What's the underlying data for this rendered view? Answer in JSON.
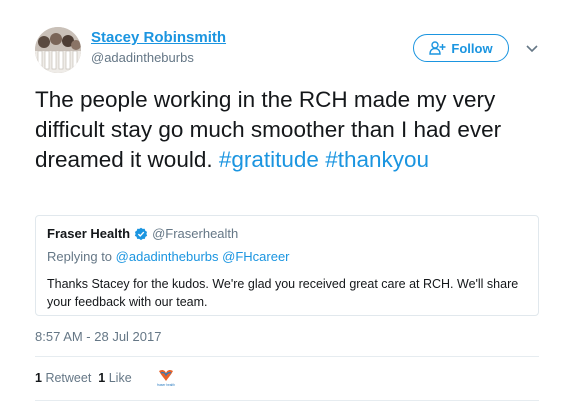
{
  "author": {
    "name": "Stacey Robinsmith",
    "handle": "@adadintheburbs",
    "follow_label": "Follow"
  },
  "tweet": {
    "text_plain": "The people working in the RCH made my very difficult stay go much smoother than I had ever dreamed it would. ",
    "hashtag_1": "#gratitude",
    "hashtag_2": "#thankyou"
  },
  "quote": {
    "name": "Fraser Health",
    "handle": "@Fraserhealth",
    "replying_prefix": "Replying to",
    "reply_to_1": "@adadintheburbs",
    "reply_to_2": "@FHcareer",
    "text": "Thanks Stacey for the kudos. We're glad you received great care at RCH. We'll share your feedback with our team."
  },
  "timestamp": "8:57 AM - 28 Jul 2017",
  "stats": {
    "retweet_count": "1",
    "retweet_label": "Retweet",
    "like_count": "1",
    "like_label": "Like",
    "liker_logo_text": "fraser health"
  },
  "colors": {
    "accent": "#1b95e0",
    "muted": "#657786",
    "text": "#14171a",
    "border": "#e1e8ed"
  },
  "icons": {
    "follow": "add-person-icon",
    "caret": "chevron-down-icon",
    "verified": "verified-badge-icon"
  }
}
